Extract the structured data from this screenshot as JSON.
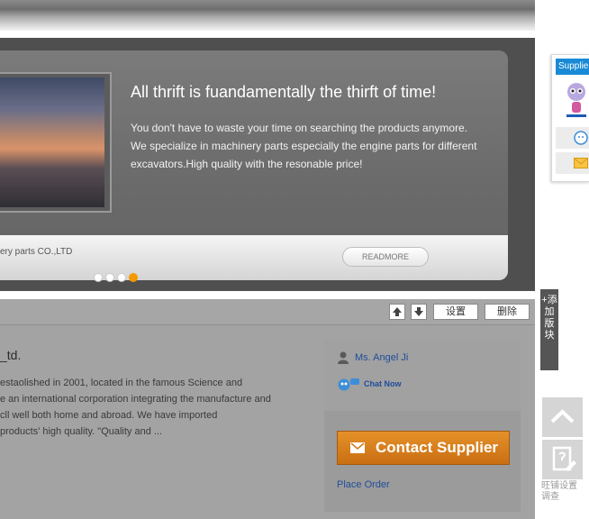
{
  "banner": {
    "headline": "All thrift is fuandamentally the thirft of time!",
    "body_lines": [
      "You don't have to waste your time on searching the products anymore.",
      "We specialize in machinery parts especially the engine parts for different",
      "excavators.High quality with the resonable price!"
    ],
    "company_caption": "ery parts CO.,LTD",
    "readmore_label": "READMORE",
    "slides": [
      "1",
      "2",
      "3",
      "4"
    ],
    "active_slide_color": "#f39800"
  },
  "toolbar": {
    "settings_label": "设置",
    "delete_label": "删除"
  },
  "company": {
    "title": "_td.",
    "description_lines": [
      "estaolished in 2001, located in the famous Science and",
      "e an international corporation integrating the manufacture and",
      "cll well both home and abroad. We have imported",
      "products' high quality. \"Quality and ..."
    ]
  },
  "contact": {
    "person_name": "Ms. Angel Ji",
    "chat_label": "Chat Now",
    "contact_button_label": "Contact Supplier",
    "place_order_label": "Place Order"
  },
  "sidebar": {
    "add_block_label": "+添加版块",
    "widget_title": "Supplie",
    "survey_label": "旺铺设置调查"
  }
}
